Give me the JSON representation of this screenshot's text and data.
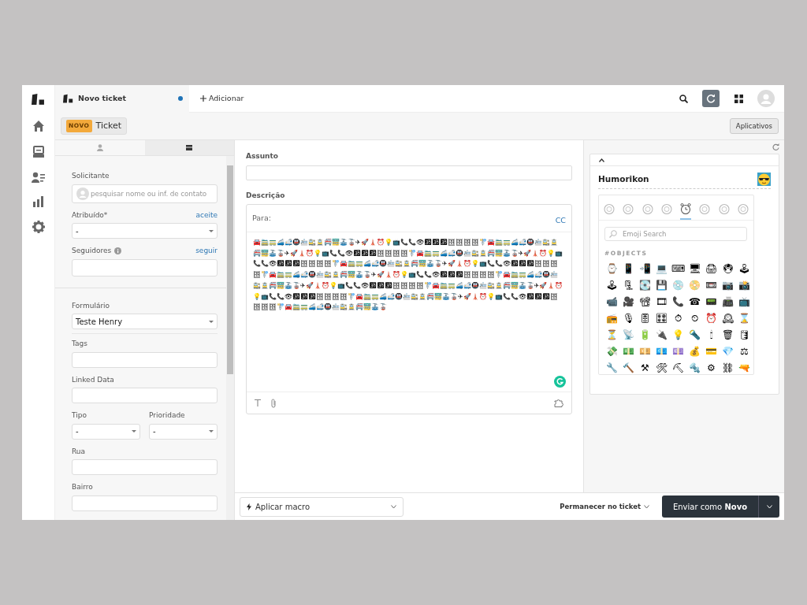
{
  "tabs": [
    {
      "title": "Novo ticket",
      "unsaved": true
    }
  ],
  "add_tab": "Adicionar",
  "header": {
    "badge": "NOVO",
    "title": "Ticket",
    "apps_button": "Aplicativos"
  },
  "side_tabs": [
    {
      "kind": "user",
      "selected": false
    },
    {
      "kind": "card",
      "selected": true
    }
  ],
  "fields": [
    {
      "kind": "search",
      "label": "Solicitante",
      "placeholder": "pesquisar nome ou inf. de contato"
    },
    {
      "kind": "select",
      "label": "Atribuído*",
      "link": "aceite",
      "value": "-"
    },
    {
      "kind": "text",
      "label": "Seguidores",
      "info": true,
      "link": "seguir"
    },
    {
      "kind": "divider"
    },
    {
      "kind": "select",
      "label": "Formulário",
      "value": "Teste Henry"
    },
    {
      "kind": "rule"
    },
    {
      "kind": "text",
      "label": "Tags"
    },
    {
      "kind": "text",
      "label": "Linked Data"
    },
    {
      "kind": "pair",
      "items": [
        {
          "label": "Tipo",
          "value": "-"
        },
        {
          "label": "Prioridade",
          "value": "-"
        }
      ]
    },
    {
      "kind": "text",
      "label": "Rua"
    },
    {
      "kind": "text",
      "label": "Bairro"
    }
  ],
  "subject": {
    "label": "Assunto"
  },
  "description": {
    "label": "Descrição",
    "to_label": "Para:",
    "cc": "CC",
    "body": "🚘🚞🚃🚄🚅🚇🚈🚉🚊🚝🚟🚠🚡✈🚀🗼⏰💡📺📞📞👁🕉🕉🕉🗄🗄🗄🗄🚏🚘🚞🚃🚄🚅🚇🚈🚉🚊🚝🚟🚠🚡✈🚀🗼⏰💡📺📞📞👁🕉🕉🕉🗄🗄🗄🗄🚏🚘🚞🚃🚄🚅🚇🚈🚉🚊🚝🚟🚠🚡✈🚀🗼⏰💡📺📞📞👁🕉🕉🕉🗄🗄🗄🗄🚏🚘🚞🚃🚄🚅🚇🚈🚉🚊🚝🚟🚠🚡✈🚀🗼⏰💡📺📞📞👁🕉🕉🕉🗄🗄🗄🗄🚏🚘🚞🚃🚄🚅🚇🚈🚉🚊🚝🚟🚠🚡✈🚀🗼⏰💡📺📞📞👁🕉🕉🕉🗄🗄🗄🗄🚏🚘🚞🚃🚄🚅🚇🚈🚉🚊🚝🚟🚠🚡✈🚀🗼⏰💡📺📞📞👁🕉🕉🕉🗄🗄🗄🗄🚏🚘🚞🚃🚄🚅🚇🚈🚉🚊🚝🚟🚠🚡✈🚀🗼⏰💡📺📞📞👁🕉🕉🕉🗄🗄🗄🗄🚏🚘🚞🚃🚄🚅🚇🚈🚉🚊🚝🚟🚠🚡✈🚀🗼⏰💡📺📞📞👁🕉🕉🕉🗄🗄🗄🗄🚏🚘🚞🚃🚄🚅🚇🚈🚉🚊🚝🚟🚠🚡"
  },
  "humorikon": {
    "title": "Humorikon",
    "categories": [
      {
        "selected": false
      },
      {
        "selected": false
      },
      {
        "selected": false
      },
      {
        "selected": false
      },
      {
        "selected": true
      },
      {
        "selected": false
      },
      {
        "selected": false
      },
      {
        "selected": false
      }
    ],
    "search_placeholder": "Emoji Search",
    "section": "#OBJECTS",
    "emojis": [
      "⌚",
      "📱",
      "📲",
      "💻",
      "⌨",
      "🖥",
      "🖨",
      "🖲",
      "🕹",
      "🕹",
      "🗜",
      "💽",
      "💾",
      "💿",
      "📀",
      "📼",
      "📷",
      "📸",
      "📹",
      "🎥",
      "📽",
      "🎞",
      "📞",
      "☎",
      "📟",
      "📠",
      "📺",
      "📻",
      "🎙",
      "🎚",
      "🎛",
      "⏱",
      "⏲",
      "⏰",
      "🕰",
      "⌛",
      "⏳",
      "📡",
      "🔋",
      "🔌",
      "💡",
      "🔦",
      "🕯",
      "🗑",
      "🛢",
      "💸",
      "💵",
      "💴",
      "💶",
      "💷",
      "💰",
      "💳",
      "💎",
      "⚖",
      "🔧",
      "🔨",
      "⚒",
      "🛠",
      "⛏",
      "🔩",
      "⚙",
      "⛓",
      "🔫"
    ]
  },
  "footer": {
    "macro": "Aplicar macro",
    "stay": "Permanecer no ticket",
    "send": "Enviar como **Novo**"
  }
}
